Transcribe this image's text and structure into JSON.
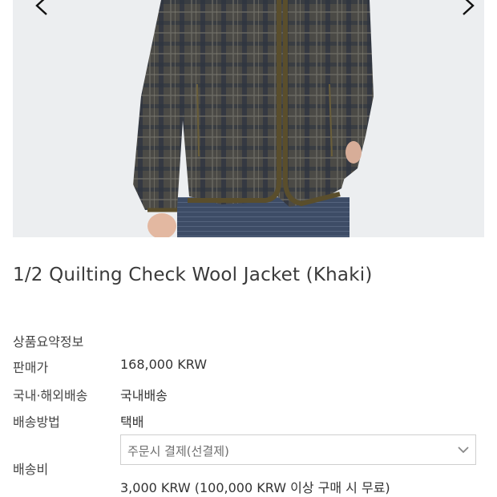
{
  "product": {
    "title": "1/2 Quilting Check Wool Jacket (Khaki)"
  },
  "image": {
    "description_icon": "product-photo",
    "prev_icon": "chevron-left-icon",
    "next_icon": "chevron-right-icon"
  },
  "info": {
    "section_label": "상품요약정보",
    "rows": [
      {
        "label": "판매가",
        "value": "168,000 KRW"
      },
      {
        "label": "국내·해외배송",
        "value": "국내배송"
      },
      {
        "label": "배송방법",
        "value": "택배"
      }
    ],
    "shipping_fee": {
      "label": "배송비",
      "select_value": "주문시 결제(선결제)",
      "fee_text": "3,000 KRW (100,000 KRW 이상 구매 시 무료)"
    }
  },
  "colors": {
    "plaid_base": "#4b4a46",
    "plaid_navy": "#2d3340",
    "trim_khaki": "#5a4e2c",
    "denim": "#3d4c66"
  }
}
